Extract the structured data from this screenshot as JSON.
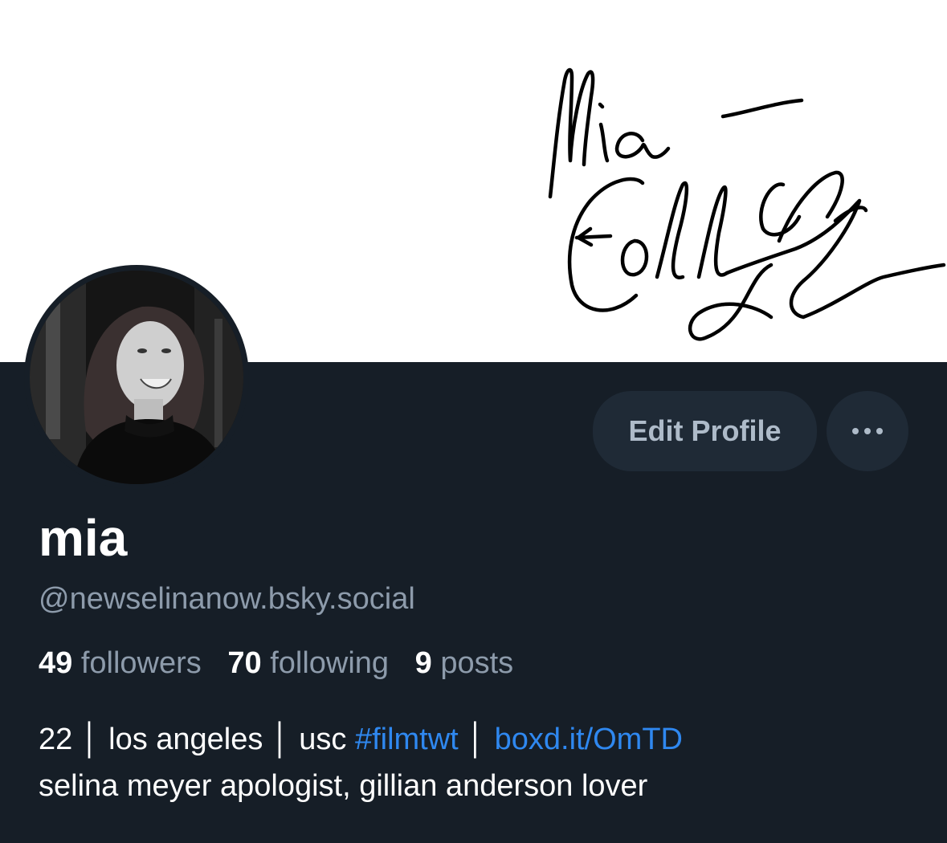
{
  "banner": {
    "signature_text": "Mia — Colleen"
  },
  "profile": {
    "display_name": "mia",
    "handle": "@newselinanow.bsky.social",
    "avatar": "profile-photo"
  },
  "actions": {
    "edit_profile_label": "Edit Profile",
    "more_icon": "ellipsis-icon"
  },
  "stats": {
    "followers_count": "49",
    "followers_label": "followers",
    "following_count": "70",
    "following_label": "following",
    "posts_count": "9",
    "posts_label": "posts"
  },
  "bio": {
    "line1_prefix": "22 │ los angeles │ usc ",
    "hashtag": "#filmtwt",
    "separator": " │ ",
    "link": "boxd.it/OmTD",
    "line2": "selina meyer apologist, gillian anderson lover"
  },
  "colors": {
    "background": "#161e27",
    "button_bg": "#1f2a36",
    "muted_text": "#8d9bab",
    "link": "#2f88f0"
  }
}
